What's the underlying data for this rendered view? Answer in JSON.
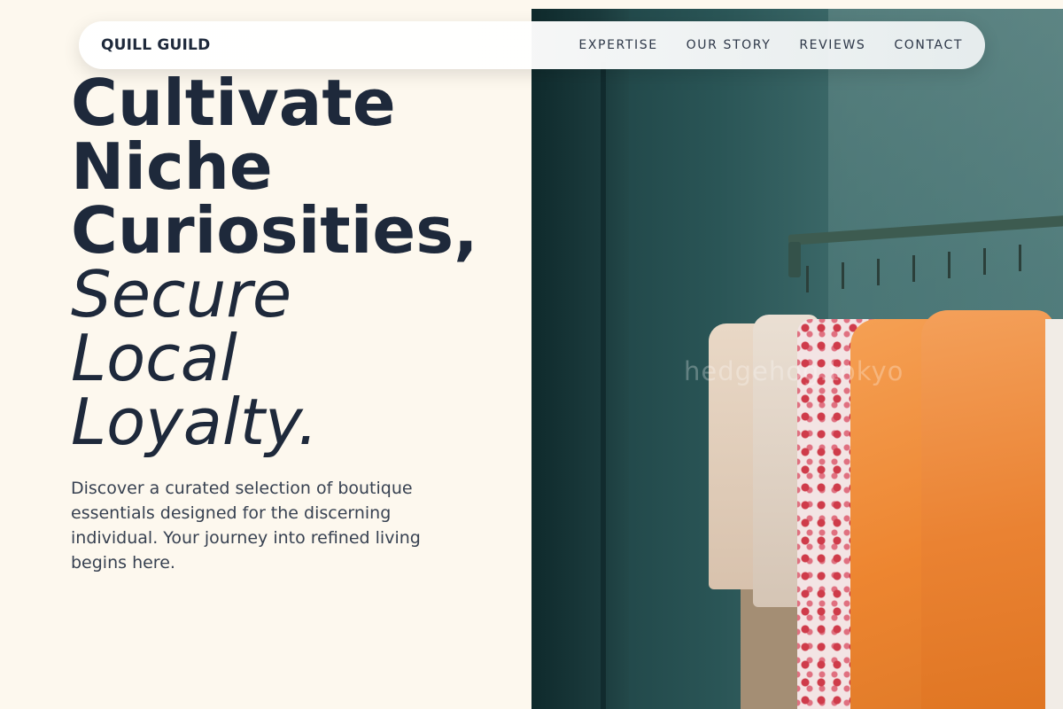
{
  "nav": {
    "brand": "QUILL GUILD",
    "links": [
      "EXPERTISE",
      "OUR STORY",
      "REVIEWS",
      "CONTACT"
    ]
  },
  "hero": {
    "headline_lines": [
      "Cultivate",
      "Niche",
      "Curiosities,"
    ],
    "headline_italic_lines": [
      "Secure",
      "Local",
      "Loyalty."
    ],
    "description": "Discover a curated selection of boutique essentials designed for the discerning individual. Your journey into refined living begins here.",
    "image_watermark": "hedgehog.tokyo"
  },
  "colors": {
    "background": "#fdf8ee",
    "heading": "#1e293b",
    "body_text": "#374151"
  }
}
